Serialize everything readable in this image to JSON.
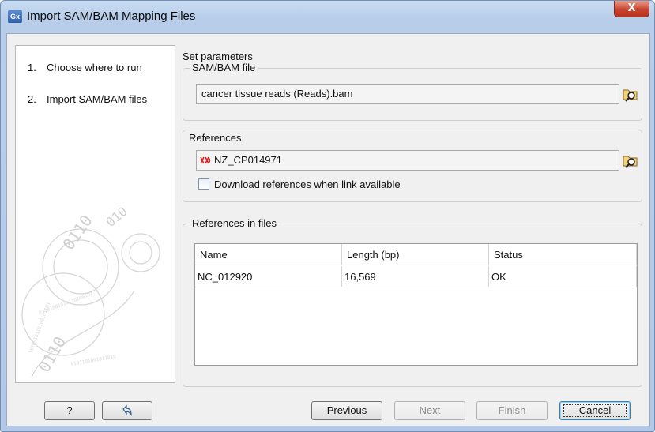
{
  "window": {
    "app_icon_text": "Gx",
    "title": "Import SAM/BAM Mapping Files",
    "close_label": "X"
  },
  "steps": [
    {
      "num": "1.",
      "label": "Choose where to run"
    },
    {
      "num": "2.",
      "label": "Import SAM/BAM files"
    }
  ],
  "section_title": "Set parameters",
  "sam_bam": {
    "label": "SAM/BAM file",
    "value": "cancer tissue reads (Reads).bam"
  },
  "references": {
    "label": "References",
    "value": "NZ_CP014971",
    "download_checkbox_label": "Download references when link available",
    "download_checked": false
  },
  "refs_in_files": {
    "label": "References in files",
    "columns": [
      "Name",
      "Length (bp)",
      "Status"
    ],
    "rows": [
      [
        "NC_012920",
        "16,569",
        "OK"
      ]
    ]
  },
  "buttons": {
    "help": "?",
    "previous": "Previous",
    "next": "Next",
    "finish": "Finish",
    "cancel": "Cancel"
  },
  "icons": [
    "gx-app-icon",
    "close-icon",
    "browse-folder-icon",
    "sequence-list-icon",
    "reset-arrow-icon"
  ]
}
